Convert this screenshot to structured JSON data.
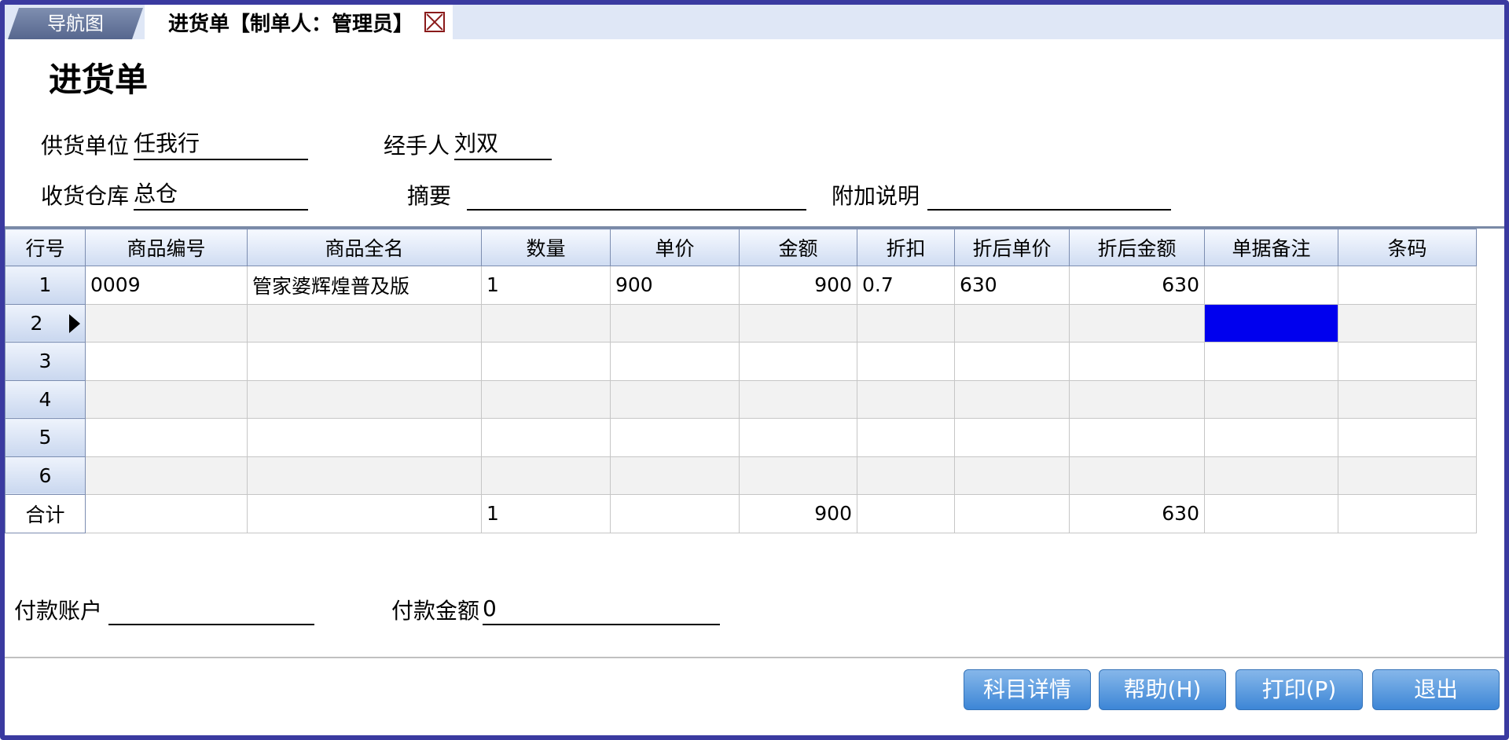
{
  "tabs": {
    "nav_label": "导航图",
    "active_label": "进货单【制单人：管理员】"
  },
  "page": {
    "title": "进货单"
  },
  "form": {
    "supplier_label": "供货单位",
    "supplier_value": "任我行",
    "handler_label": "经手人",
    "handler_value": "刘双",
    "warehouse_label": "收货仓库",
    "warehouse_value": "总仓",
    "summary_label": "摘要",
    "summary_value": "",
    "note_label": "附加说明",
    "note_value": ""
  },
  "table": {
    "headers": [
      "行号",
      "商品编号",
      "商品全名",
      "数量",
      "单价",
      "金额",
      "折扣",
      "折后单价",
      "折后金额",
      "单据备注",
      "条码"
    ],
    "rows": [
      [
        "1",
        "0009",
        "管家婆辉煌普及版",
        "1",
        "900",
        "900",
        "0.7",
        "630",
        "630",
        "",
        ""
      ],
      [
        "2",
        "",
        "",
        "",
        "",
        "",
        "",
        "",
        "",
        "",
        ""
      ],
      [
        "3",
        "",
        "",
        "",
        "",
        "",
        "",
        "",
        "",
        "",
        ""
      ],
      [
        "4",
        "",
        "",
        "",
        "",
        "",
        "",
        "",
        "",
        "",
        ""
      ],
      [
        "5",
        "",
        "",
        "",
        "",
        "",
        "",
        "",
        "",
        "",
        ""
      ],
      [
        "6",
        "",
        "",
        "",
        "",
        "",
        "",
        "",
        "",
        "",
        ""
      ]
    ],
    "total": [
      "合计",
      "",
      "",
      "1",
      "",
      "900",
      "",
      "",
      "630",
      "",
      ""
    ]
  },
  "payment": {
    "account_label": "付款账户",
    "account_value": "",
    "amount_label": "付款金额",
    "amount_value": "0"
  },
  "buttons": {
    "details": "科目详情",
    "help": "帮助(H)",
    "print": "打印(P)",
    "exit": "退出"
  },
  "colors": {
    "frame": "#3a3aa0",
    "selection": "#0000ee",
    "button": "#3d86d6"
  }
}
